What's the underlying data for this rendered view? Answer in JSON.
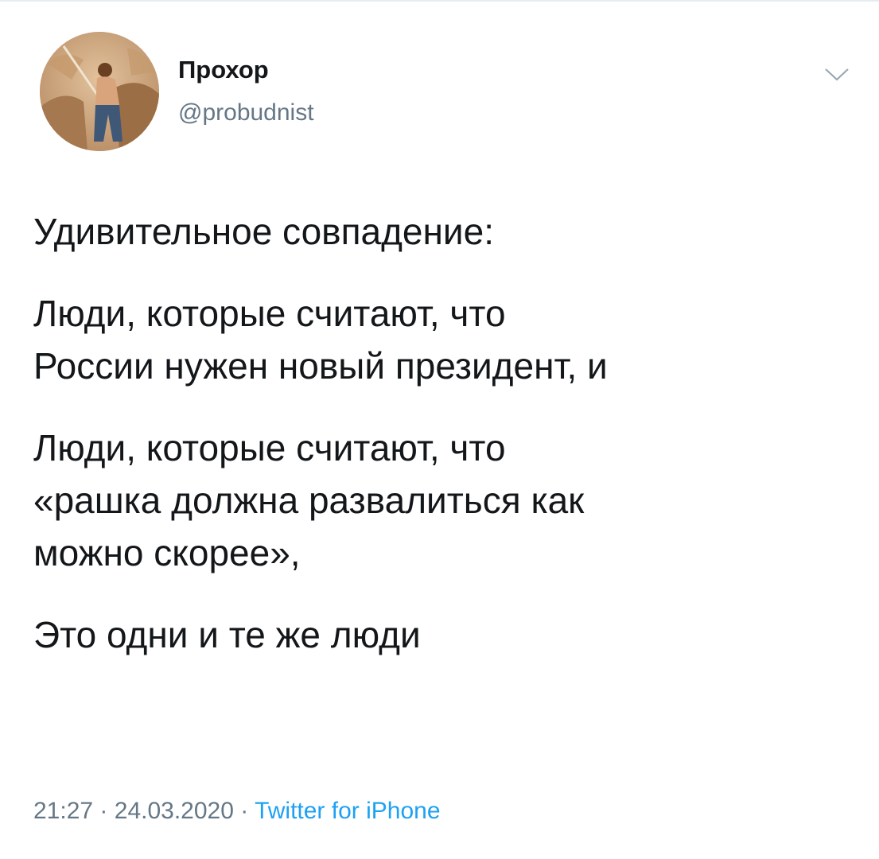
{
  "tweet": {
    "author": {
      "name": "Прохор",
      "handle": "@probudnist"
    },
    "menu_icon": "chevron-down-icon",
    "body": {
      "paragraph_1": [
        "Удивительное совпадение:"
      ],
      "paragraph_2": [
        "Люди, которые считают, что",
        "России нужен новый президент, и"
      ],
      "paragraph_3": [
        "Люди, которые считают, что",
        "«рашка должна развалиться как",
        "можно скорее»,"
      ],
      "paragraph_4": [
        "Это одни и те же люди"
      ]
    },
    "meta": {
      "time": "21:27",
      "separator": "·",
      "date": "24.03.2020",
      "source": "Twitter for iPhone"
    }
  },
  "colors": {
    "text": "#14171a",
    "secondary": "#657786",
    "link": "#1da1f2",
    "divider": "#e6ecf0"
  }
}
